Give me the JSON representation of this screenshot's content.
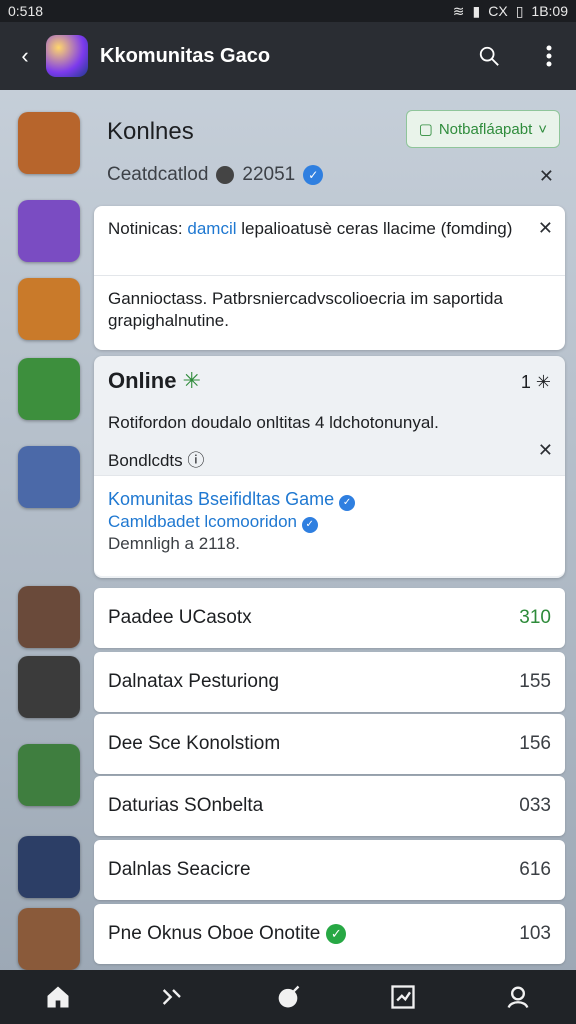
{
  "status_bar": {
    "time": "0:518",
    "right_time": "1B:09",
    "signal_text": "CX"
  },
  "app_bar": {
    "title": "Kkomunitas Gaco"
  },
  "header": {
    "title": "Konlnes",
    "subtitle": "Ceatdcatlod",
    "count": "22051",
    "notif_button": "Notbafláapabt"
  },
  "cards": {
    "notice1": {
      "prefix": "Notinicas:",
      "accent": "damcil",
      "text": "lepalioatusè ceras llacime (fomding)"
    },
    "notice2": {
      "text": "Gannioctass. Patbrsniercadvscolioecria im saportida grapighalnutine."
    },
    "online": {
      "title": "Online",
      "count": "1",
      "desc": "Rotifordon doudalo onltitas 4 ldchotonunyal.",
      "label": "Bondlcdts",
      "featured": {
        "title": "Komunitas Bseifidltas Game",
        "subtitle": "Camldbadet lcomooridon",
        "meta": "Demnligh a 2118."
      }
    }
  },
  "list": [
    {
      "name": "Paadee UCasotx",
      "count": "310",
      "count_color": "#2e8b3a"
    },
    {
      "name": "Dalnatax Pesturiong",
      "count": "155",
      "count_color": "#3b3f44"
    },
    {
      "name": "Dee Sce Konolstiom",
      "count": "156",
      "count_color": "#3b3f44"
    },
    {
      "name": "Daturias SOnbelta",
      "count": "033",
      "count_color": "#3b3f44"
    },
    {
      "name": "Dalnlas Seacicre",
      "count": "616",
      "count_color": "#3b3f44"
    },
    {
      "name": "Pne Oknus Oboe Onotite",
      "count": "103",
      "count_color": "#3b3f44"
    }
  ],
  "avatars": [
    "#b7652c",
    "#7a4cc2",
    "#c97a2a",
    "#3d8f3d",
    "#4b69a8",
    "#6a4a3a",
    "#3b3b3b",
    "#3f7e3f",
    "#2c3e66",
    "#8a5a3a"
  ]
}
